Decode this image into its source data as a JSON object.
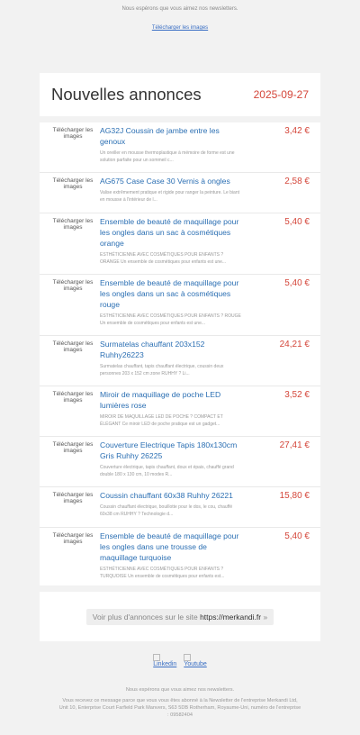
{
  "top_note": "Nous espérons que vous aimez nos newsletters.",
  "logo_alt": "Télécharger les images",
  "header": {
    "title": "Nouvelles annonces",
    "date": "2025-09-27"
  },
  "image_alt": "Télécharger les images",
  "items": [
    {
      "title": "AG32J Coussin de jambe entre les genoux",
      "desc": "Un oreiller en mousse thermoplastique à mémoire de forme est une solution parfaite pour un sommeil c...",
      "price": "3,42 €"
    },
    {
      "title": "AG675 Case Case 30 Vernis à ongles",
      "desc": "Valise extrêmement pratique et rigide pour ranger la peinture. Le biant en mousse à l'intérieur de l...",
      "price": "2,58 €"
    },
    {
      "title": "Ensemble de beauté de maquillage pour les ongles dans un sac à cosmétiques orange",
      "desc": "ESTHÉTICIENNE AVEC COSMÉTIQUES POUR ENFANTS ? ORANGE Un ensemble de cosmétiques pour enfants est une...",
      "price": "5,40 €"
    },
    {
      "title": "Ensemble de beauté de maquillage pour les ongles dans un sac à cosmétiques rouge",
      "desc": "ESTHÉTICIENNE AVEC COSMÉTIQUES POUR ENFANTS ? ROUGE Un ensemble de cosmétiques pour enfants est une...",
      "price": "5,40 €"
    },
    {
      "title": "Surmatelas chauffant 203x152 Ruhhy26223",
      "desc": "Surmatelas chauffant, tapis chauffant électrique, coussin deux personnes 203 x 152 cm zone RUHHY ? Li...",
      "price": "24,21 €"
    },
    {
      "title": "Miroir de maquillage de poche LED lumières rose",
      "desc": "MIROIR DE MAQUILLAGE LED DE POCHE ? COMPACT ET ÉLÉGANT Ce miroir LED de poche pratique est un gadget...",
      "price": "3,52 €"
    },
    {
      "title": "Couverture Electrique Tapis 180x130cm Gris Ruhhy 26225",
      "desc": "Couverture électrique, tapis chauffant, doux et épais, chauffé grand double 180 x 130 cm, 10 modes R...",
      "price": "27,41 €"
    },
    {
      "title": "Coussin chauffant 60x38 Ruhhy 26221",
      "desc": "Coussin chauffant électrique, bouillotte pour le dos, le cou, chauffé 60x38 cm RUHHY ? Technologie d...",
      "price": "15,80 €"
    },
    {
      "title": "Ensemble de beauté de maquillage pour les ongles dans une trousse de maquillage turquoise",
      "desc": "ESTHÉTICIENNE AVEC COSMÉTIQUES POUR ENFANTS ? TURQUOISE Un ensemble de cosmétiques pour enfants est...",
      "price": "5,40 €"
    }
  ],
  "more": {
    "prefix": "Voir plus d'annonces sur le site ",
    "url": "https://merkandi.fr",
    "suffix": " »"
  },
  "social": [
    {
      "label": "Linkedin",
      "icon": "linkedin-icon"
    },
    {
      "label": "Youtube",
      "icon": "youtube-icon"
    }
  ],
  "footer_note": "Nous espérons que vous aimez nos newsletters.",
  "footer_legal": "Vous recevez ce message parce que vous vous êtes abonné à la Newsletter de l'entreprise Merkandi Ltd, Unit 10, Enterprise Court Farfield Park Manvers, S63 5DB Rotherham, Royaume-Uni, numéro de l'entreprise : 09582404"
}
